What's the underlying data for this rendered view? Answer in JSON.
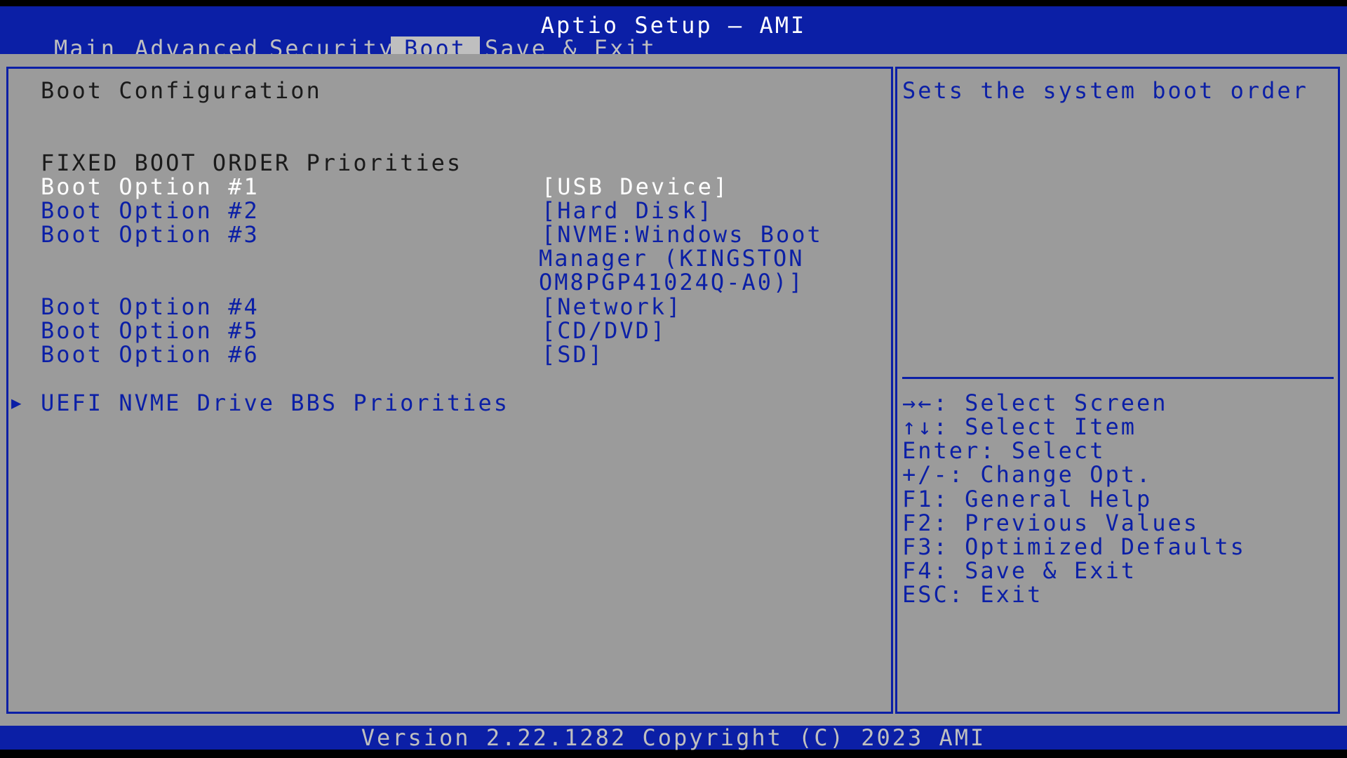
{
  "header": {
    "title": "Aptio Setup – AMI",
    "tabs": [
      "Main",
      "Advanced",
      "Security",
      "Boot",
      "Save & Exit"
    ],
    "active_tab": "Boot"
  },
  "main": {
    "section_title": "Boot Configuration",
    "group_title": "FIXED BOOT ORDER Priorities",
    "boot_options": [
      {
        "label": "Boot Option #1",
        "value": "[USB Device]"
      },
      {
        "label": "Boot Option #2",
        "value": "[Hard Disk]"
      },
      {
        "label": "Boot Option #3",
        "value_lines": [
          "[NVME:Windows Boot",
          "Manager (KINGSTON",
          "OM8PGP41024Q-A0)]"
        ]
      },
      {
        "label": "Boot Option #4",
        "value": "[Network]"
      },
      {
        "label": "Boot Option #5",
        "value": "[CD/DVD]"
      },
      {
        "label": "Boot Option #6",
        "value": "[SD]"
      }
    ],
    "submenu": "UEFI NVME Drive BBS Priorities"
  },
  "help": {
    "description": "Sets the system boot order",
    "keys": [
      "→←: Select Screen",
      "↑↓: Select Item",
      "Enter: Select",
      "+/-: Change Opt.",
      "F1: General Help",
      "F2: Previous Values",
      "F3: Optimized Defaults",
      "F4: Save & Exit",
      "ESC: Exit"
    ]
  },
  "footer": {
    "version": "Version 2.22.1282 Copyright (C) 2023 AMI"
  },
  "colors": {
    "bar_blue": "#0b1fa6",
    "panel_grey": "#9b9b9b",
    "text_light": "#bfbfbf",
    "selected_text": "#ffffff"
  }
}
